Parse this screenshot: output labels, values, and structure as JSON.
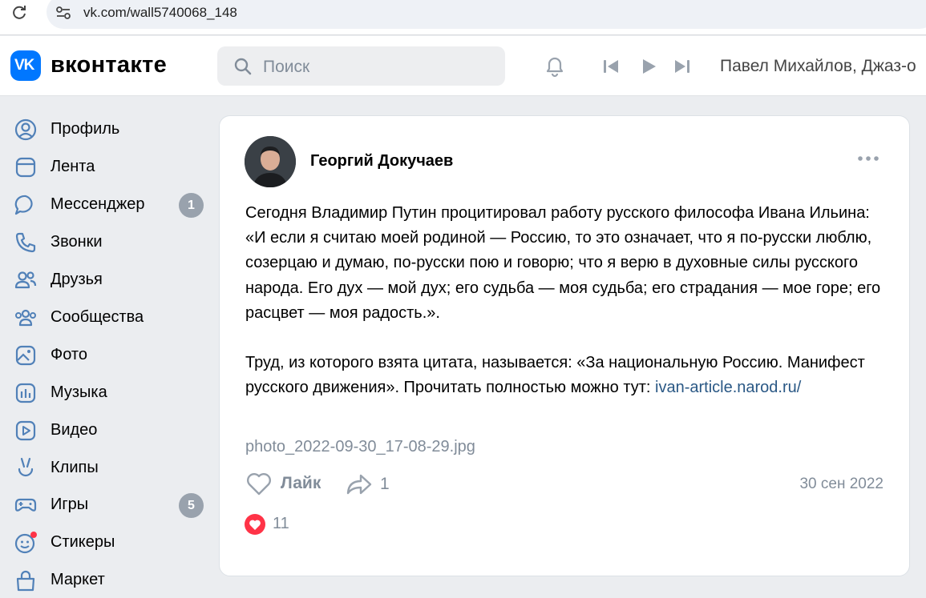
{
  "browser": {
    "url": "vk.com/wall5740068_148"
  },
  "header": {
    "logo_text": "VK",
    "wordmark": "вконтакте",
    "search_placeholder": "Поиск",
    "now_playing": "Павел Михайлов, Джаз-о"
  },
  "sidebar": {
    "items": [
      {
        "label": "Профиль",
        "icon": "profile-icon"
      },
      {
        "label": "Лента",
        "icon": "feed-icon"
      },
      {
        "label": "Мессенджер",
        "icon": "messenger-icon",
        "badge": "1"
      },
      {
        "label": "Звонки",
        "icon": "phone-icon"
      },
      {
        "label": "Друзья",
        "icon": "friends-icon"
      },
      {
        "label": "Сообщества",
        "icon": "communities-icon"
      },
      {
        "label": "Фото",
        "icon": "photo-icon"
      },
      {
        "label": "Музыка",
        "icon": "music-icon"
      },
      {
        "label": "Видео",
        "icon": "video-icon"
      },
      {
        "label": "Клипы",
        "icon": "clips-icon"
      },
      {
        "label": "Игры",
        "icon": "games-icon",
        "badge": "5"
      },
      {
        "label": "Стикеры",
        "icon": "stickers-icon"
      },
      {
        "label": "Маркет",
        "icon": "market-icon"
      }
    ]
  },
  "post": {
    "author": "Георгий Докучаев",
    "text_paragraph_1": "Сегодня Владимир Путин процитировал работу русского философа Ивана Ильина: «И если я считаю моей родиной — Россию, то это означает, что я по-русски люблю, созерцаю и думаю, по-русски пою и говорю; что я верю в духовные силы русского народа. Его дух — мой дух; его судьба — моя судьба; его страдания — мое горе; его расцвет — моя радость.».",
    "text_paragraph_2": "Труд, из которого взята цитата, называется: «За национальную Россию. Манифест русского движения». Прочитать полностью можно тут: ",
    "link_text": "ivan-article.narod.ru/",
    "attachment": "photo_2022-09-30_17-08-29.jpg",
    "like_label": "Лайк",
    "share_count": "1",
    "date": "30 сен 2022",
    "reaction_count": "11"
  },
  "colors": {
    "brand": "#0077ff",
    "link": "#2a5885",
    "muted": "#818c99",
    "badge": "#99a2ad",
    "heart": "#ff3347"
  }
}
